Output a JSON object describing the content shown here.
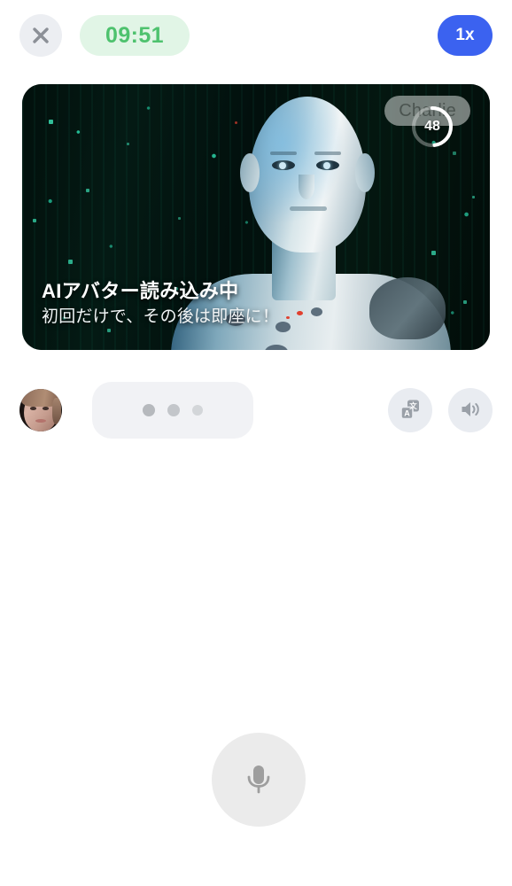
{
  "topbar": {
    "close_label": "×",
    "close_icon": "close-icon",
    "timer": "09:51",
    "speed_label": "1x"
  },
  "video": {
    "name_badge": "Charlie",
    "progress_value": "48",
    "progress_percent": 48,
    "caption_title": "AIアバター読み込み中",
    "caption_subtitle": "初回だけで、その後は即座に！",
    "background_description": "matrix-particles",
    "subject": "ai-android-avatar"
  },
  "chat": {
    "avatar_name": "user-avatar",
    "typing_indicator": "typing-dots",
    "actions": [
      {
        "name": "translate-button",
        "icon": "translate-icon"
      },
      {
        "name": "speaker-button",
        "icon": "speaker-icon"
      }
    ]
  },
  "footer": {
    "mic_icon": "microphone-icon"
  },
  "colors": {
    "accent_blue": "#3b62f0",
    "timer_text": "#4ec26e",
    "timer_bg": "#e1f5e6",
    "button_bg": "#e9ecf1",
    "mic_bg": "#ebebeb",
    "bubble_bg": "#f1f2f5",
    "page_bg": "#ffffff"
  }
}
